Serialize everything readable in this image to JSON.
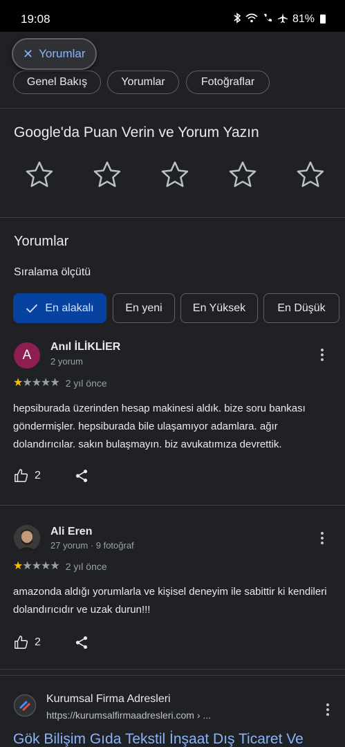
{
  "status_bar": {
    "time": "19:08",
    "battery": "81%",
    "icons": [
      "bluetooth-icon",
      "wifi-icon",
      "wifi-calling-icon",
      "airplane-icon",
      "battery-icon"
    ]
  },
  "filter": {
    "label": "Yorumlar"
  },
  "tabs": [
    {
      "label": "Genel Bakış"
    },
    {
      "label": "Yorumlar"
    },
    {
      "label": "Fotoğraflar"
    }
  ],
  "rate": {
    "title": "Google'da Puan Verin ve Yorum Yazın",
    "star_count": 5
  },
  "reviews_section": {
    "heading": "Yorumlar",
    "sort_label": "Sıralama ölçütü",
    "sort_options": [
      {
        "label": "En alakalı",
        "selected": true
      },
      {
        "label": "En yeni",
        "selected": false
      },
      {
        "label": "En Yüksek",
        "selected": false
      },
      {
        "label": "En Düşük",
        "selected": false
      }
    ]
  },
  "reviews": [
    {
      "avatar_letter": "A",
      "name": "Anıl İLİKLİER",
      "meta": "2 yorum",
      "rating": 1,
      "date": "2 yıl önce",
      "text": "hepsiburada üzerinden hesap makinesi aldık. bize soru bankası göndermişler. hepsiburada bile ulaşamıyor adamlara. ağır dolandırıcılar. sakın bulaşmayın. biz avukatımıza devrettik.",
      "likes": "2"
    },
    {
      "avatar_letter": "",
      "name": "Ali Eren",
      "meta": "27 yorum · 9 fotoğraf",
      "rating": 1,
      "date": "2 yıl önce",
      "text": "amazonda aldığı yorumlarla ve kişisel deneyim ile sabittir ki kendileri dolandırıcıdır ve uzak durun!!!",
      "likes": "2"
    }
  ],
  "result": {
    "site_name": "Kurumsal Firma Adresleri",
    "url": "https://kurumsalfirmaadresleri.com › ...",
    "title": "Gök Bilişim Gıda Tekstil İnşaat Dış Ticaret Ve"
  },
  "colors": {
    "background": "#202124",
    "accent_blue": "#8ab4f8",
    "selected_chip": "#0842a0",
    "star_on": "#fbbc04",
    "avatar_a": "#8e1e50"
  }
}
